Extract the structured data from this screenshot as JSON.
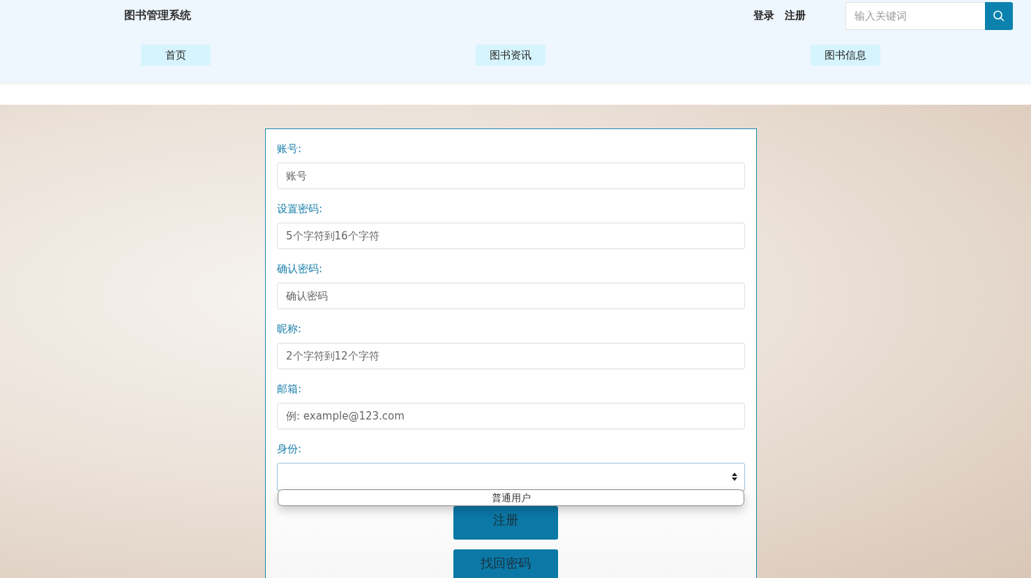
{
  "header": {
    "title": "图书管理系统",
    "links": [
      "登录",
      "注册"
    ],
    "search": {
      "placeholder": "输入关键词"
    }
  },
  "nav": [
    {
      "label": "首页"
    },
    {
      "label": "图书资讯"
    },
    {
      "label": "图书信息"
    }
  ],
  "form": {
    "fields": [
      {
        "label": "账号:",
        "placeholder": "账号"
      },
      {
        "label": "设置密码:",
        "placeholder": "5个字符到16个字符"
      },
      {
        "label": "确认密码:",
        "placeholder": "确认密码"
      },
      {
        "label": "昵称:",
        "placeholder": "2个字符到12个字符"
      },
      {
        "label": "邮箱:",
        "placeholder": "例: example@123.com"
      }
    ],
    "identity": {
      "label": "身份:",
      "expanded": true,
      "options": [
        "普通用户"
      ]
    },
    "buttons": [
      "注册",
      "找回密码"
    ]
  }
}
